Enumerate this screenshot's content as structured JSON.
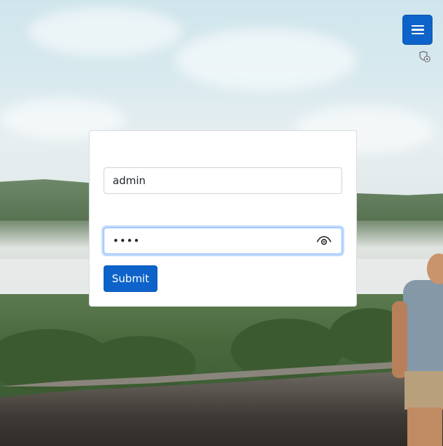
{
  "header": {
    "menu_icon": "hamburger-menu-icon",
    "secondary_icon": "shield-icon"
  },
  "login": {
    "username_value": "admin",
    "password_masked": "••••",
    "password_visibility_icon": "eye-icon",
    "submit_label": "Submit"
  },
  "colors": {
    "primary": "#0d63c9",
    "focus_ring": "#86b7fe",
    "card_bg": "#ffffff"
  }
}
